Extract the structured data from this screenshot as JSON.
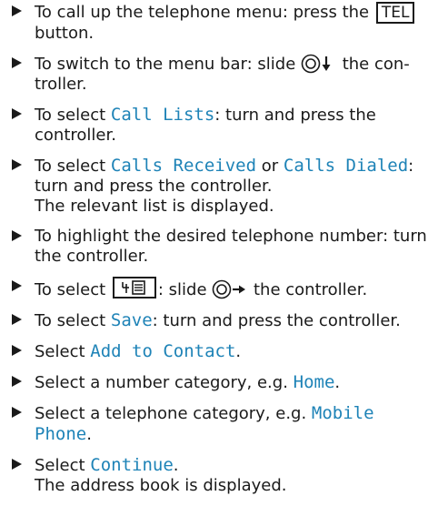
{
  "steps": [
    {
      "a": "To call up the telephone menu: press the ",
      "key": "TEL",
      "b": " button."
    },
    {
      "a": "To switch to the menu bar: slide ",
      "b": " the con-troller."
    },
    {
      "a": "To select ",
      "hl": "Call Lists",
      "b": ": turn and press the controller."
    },
    {
      "a": "To select ",
      "hl1": "Calls Received",
      "mid": " or ",
      "hl2": "Calls Dialed",
      "b": ": turn and press the controller.",
      "result": "The relevant list is displayed."
    },
    {
      "a": "To highlight the desired telephone number: turn the controller."
    },
    {
      "a": "To select ",
      "b": ": slide ",
      "c": " the controller."
    },
    {
      "a": "To select ",
      "hl": "Save",
      "b": ": turn and press the controller."
    },
    {
      "a": "Select ",
      "hl": "Add to Contact",
      "b": "."
    },
    {
      "a": "Select a number category, e.g. ",
      "hl": "Home",
      "b": "."
    },
    {
      "a": "Select a telephone category, e.g. ",
      "hl": "Mobile Phone",
      "b": "."
    },
    {
      "a": "Select ",
      "hl": "Continue",
      "b": ".",
      "result": "The address book is displayed."
    }
  ],
  "icons": {
    "bullet": "triangle-bullet-icon",
    "controller_down": "controller-slide-down-icon",
    "controller_right": "controller-slide-right-icon",
    "save_to_phonebook": "save-to-phonebook-icon"
  },
  "colors": {
    "text": "#1a1a1a",
    "highlight": "#1e83b7"
  }
}
